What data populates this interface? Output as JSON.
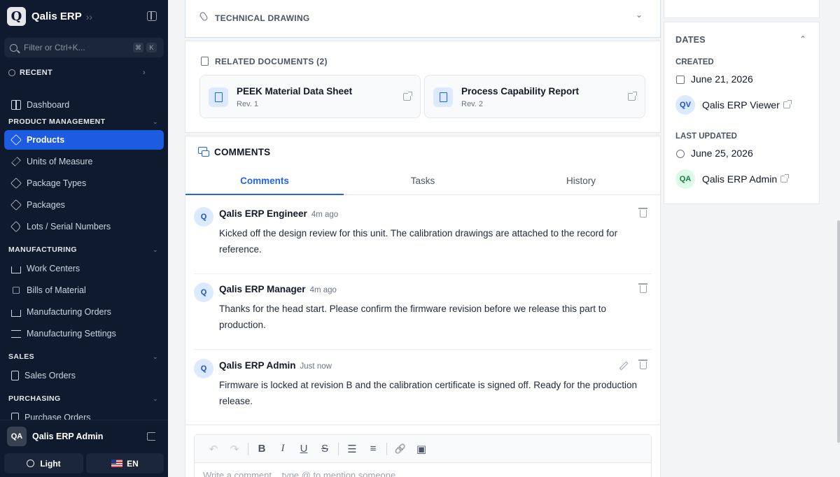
{
  "app": {
    "name": "Qalis ERP",
    "logo_letter": "Q"
  },
  "search": {
    "placeholder": "Filter or Ctrl+K...",
    "kbd1": "⌘",
    "kbd2": "K"
  },
  "nav": {
    "recent": "RECENT",
    "dashboard": "Dashboard",
    "sections": {
      "product_management": "PRODUCT MANAGEMENT",
      "manufacturing": "MANUFACTURING",
      "sales": "SALES",
      "purchasing": "PURCHASING"
    },
    "product_items": [
      "Products",
      "Units of Measure",
      "Package Types",
      "Packages",
      "Lots / Serial Numbers"
    ],
    "manufacturing_items": [
      "Work Centers",
      "Bills of Material",
      "Manufacturing Orders",
      "Manufacturing Settings"
    ],
    "sales_items": [
      "Sales Orders"
    ],
    "purchasing_items": [
      "Purchase Orders"
    ]
  },
  "user": {
    "initials": "QA",
    "name": "Qalis ERP Admin"
  },
  "theme": {
    "label": "Light"
  },
  "language": {
    "label": "EN"
  },
  "technical_drawing": {
    "title": "TECHNICAL DRAWING"
  },
  "related_documents": {
    "title": "RELATED DOCUMENTS (2)",
    "items": [
      {
        "title": "PEEK Material Data Sheet",
        "rev": "Rev. 1"
      },
      {
        "title": "Process Capability Report",
        "rev": "Rev. 2"
      }
    ]
  },
  "comments": {
    "title": "COMMENTS",
    "tabs": [
      "Comments",
      "Tasks",
      "History"
    ],
    "active_tab": "Comments",
    "items": [
      {
        "avatar": "Q",
        "author": "Qalis ERP Engineer",
        "time": "4m ago",
        "text": "Kicked off the design review for this unit. The calibration drawings are attached to the record for reference."
      },
      {
        "avatar": "Q",
        "author": "Qalis ERP Manager",
        "time": "4m ago",
        "text": "Thanks for the head start. Please confirm the firmware revision before we release this part to production."
      },
      {
        "avatar": "Q",
        "author": "Qalis ERP Admin",
        "time": "Just now",
        "text": "Firmware is locked at revision B and the calibration certificate is signed off. Ready for the production release."
      }
    ],
    "editor_placeholder": "Write a comment... type @ to mention someone"
  },
  "toolbar": {
    "undo": "↶",
    "redo": "↷",
    "bold": "B",
    "italic": "I",
    "underline": "U",
    "strike": "S",
    "bullet": "☰",
    "ordered": "≡",
    "link": "🔗",
    "image": "▣"
  },
  "dates": {
    "title": "DATES",
    "created_label": "CREATED",
    "created_date": "June 21, 2026",
    "created_by_initials": "QV",
    "created_by": "Qalis ERP Viewer",
    "updated_label": "LAST UPDATED",
    "updated_date": "June 25, 2026",
    "updated_by_initials": "QA",
    "updated_by": "Qalis ERP Admin"
  },
  "colors": {
    "accent": "#1d5be0",
    "sidebar_bg": "#0f1a2e",
    "link_blue": "#2563eb"
  }
}
